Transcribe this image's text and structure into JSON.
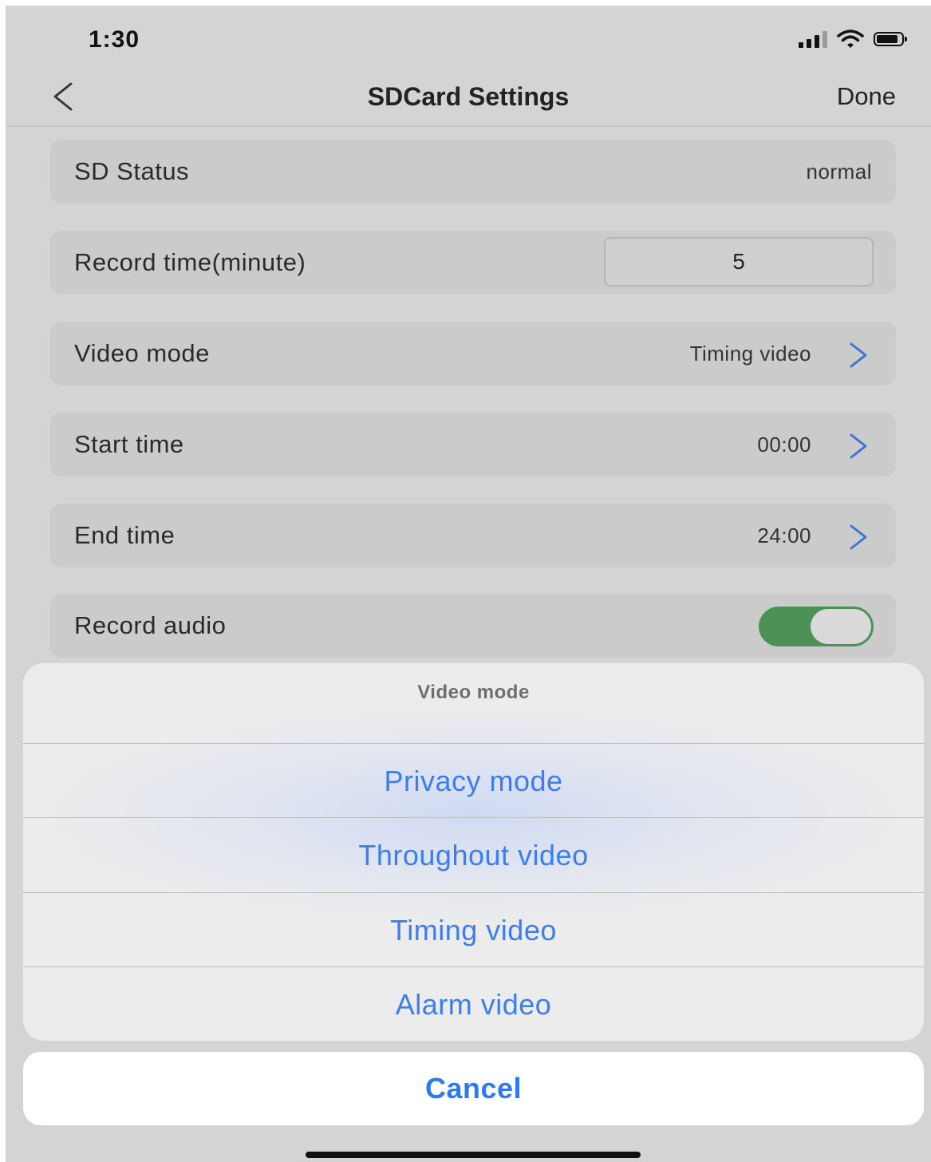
{
  "status_bar": {
    "time": "1:30"
  },
  "nav": {
    "title": "SDCard Settings",
    "done_label": "Done"
  },
  "settings": {
    "sd_status": {
      "label": "SD Status",
      "value": "normal"
    },
    "record_time": {
      "label": "Record time(minute)",
      "value": "5"
    },
    "video_mode": {
      "label": "Video mode",
      "value": "Timing video"
    },
    "start_time": {
      "label": "Start time",
      "value": "00:00"
    },
    "end_time": {
      "label": "End time",
      "value": "24:00"
    },
    "record_audio": {
      "label": "Record audio",
      "enabled": true
    }
  },
  "action_sheet": {
    "title": "Video mode",
    "options": [
      {
        "label": "Privacy mode"
      },
      {
        "label": "Throughout video"
      },
      {
        "label": "Timing video"
      },
      {
        "label": "Alarm video"
      }
    ],
    "cancel_label": "Cancel"
  },
  "colors": {
    "accent_blue": "#3b7ef0",
    "toggle_on": "#4c9155",
    "chevron": "#3f72d6"
  },
  "icons": {
    "back": "chevron-left-icon",
    "row_chevron": "chevron-right-icon",
    "signal": "cellular-signal-icon",
    "wifi": "wifi-icon",
    "battery": "battery-icon"
  }
}
